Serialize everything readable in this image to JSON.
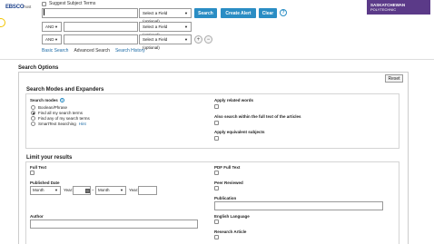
{
  "header": {
    "logo_text": "EBSCO",
    "logo_suffix": "host",
    "suggest_label": "Suggest Subject Terms",
    "brand_line1": "SASKATCHEWAN",
    "brand_line2": "POLYTECHNIC"
  },
  "search_rows": [
    {
      "bool": "",
      "value": "",
      "field": "Select a Field (optional)"
    },
    {
      "bool": "AND",
      "value": "",
      "field": "Select a Field (optional)"
    },
    {
      "bool": "AND",
      "value": "",
      "field": "Select a Field (optional)"
    }
  ],
  "buttons": {
    "search": "Search",
    "create_alert": "Create Alert",
    "clear": "Clear",
    "help": "?",
    "add_row": "+",
    "remove_row": "−"
  },
  "sublinks": {
    "basic": "Basic Search",
    "advanced": "Advanced Search",
    "history": "Search History"
  },
  "options": {
    "title": "Search Options",
    "reset": "Reset",
    "modes_section": {
      "title": "Search Modes and Expanders",
      "search_modes_label": "Search modes",
      "modes": [
        {
          "label": "Boolean/Phrase",
          "selected": false
        },
        {
          "label": "Find all my search terms",
          "selected": true
        },
        {
          "label": "Find any of my search terms",
          "selected": false
        },
        {
          "label": "SmartText Searching",
          "selected": false,
          "hint": "Hint"
        }
      ],
      "expanders": [
        {
          "label": "Apply related words"
        },
        {
          "label": "Also search within the full text of the articles"
        },
        {
          "label": "Apply equivalent subjects"
        }
      ]
    },
    "limit_section": {
      "title": "Limit your results",
      "full_text": "Full Text",
      "published_date": "Published Date",
      "month_from": "Month",
      "year_label": "Year:",
      "dash": "–",
      "month_to": "Month",
      "year_label2": "Year:",
      "author": "Author",
      "pdf_full_text": "PDF Full Text",
      "peer_reviewed": "Peer Reviewed",
      "publication": "Publication",
      "english_language": "English Language",
      "research_article": "Research Article"
    }
  }
}
